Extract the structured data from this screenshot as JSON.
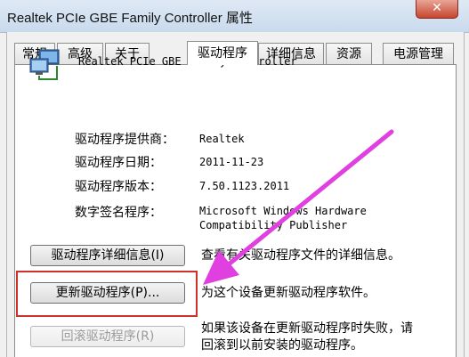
{
  "window": {
    "title": "Realtek PCIe GBE Family Controller 属性",
    "close_glyph": "✕"
  },
  "tabs": [
    {
      "label": "常规",
      "active": false
    },
    {
      "label": "高级",
      "active": false
    },
    {
      "label": "关于",
      "active": false
    },
    {
      "label": "驱动程序",
      "active": true
    },
    {
      "label": "详细信息",
      "active": false
    },
    {
      "label": "资源",
      "active": false
    },
    {
      "label": "电源管理",
      "active": false
    }
  ],
  "device": {
    "icon": "network-adapter-icon",
    "name": "Realtek PCIe GBE Family Controller"
  },
  "driver_info": {
    "provider_label": "驱动程序提供商：",
    "provider_value": "Realtek",
    "date_label": "驱动程序日期：",
    "date_value": "2011-11-23",
    "version_label": "驱动程序版本：",
    "version_value": "7.50.1123.2011",
    "signer_label": "数字签名程序：",
    "signer_value_line1": "Microsoft Windows Hardware",
    "signer_value_line2": "Compatibility Publisher"
  },
  "actions": {
    "details_button": "驱动程序详细信息(I)",
    "details_desc": "查看有关驱动程序文件的详细信息。",
    "update_button": "更新驱动程序(P)...",
    "update_desc": "为这个设备更新驱动程序软件。",
    "rollback_button": "回滚驱动程序(R)",
    "rollback_desc_line1": "如果该设备在更新驱动程序时失败，请",
    "rollback_desc_line2": "回滚到以前安装的驱动程序。"
  },
  "colors": {
    "annotation_arrow": "#e040e0",
    "highlight_box": "#d0302a"
  }
}
